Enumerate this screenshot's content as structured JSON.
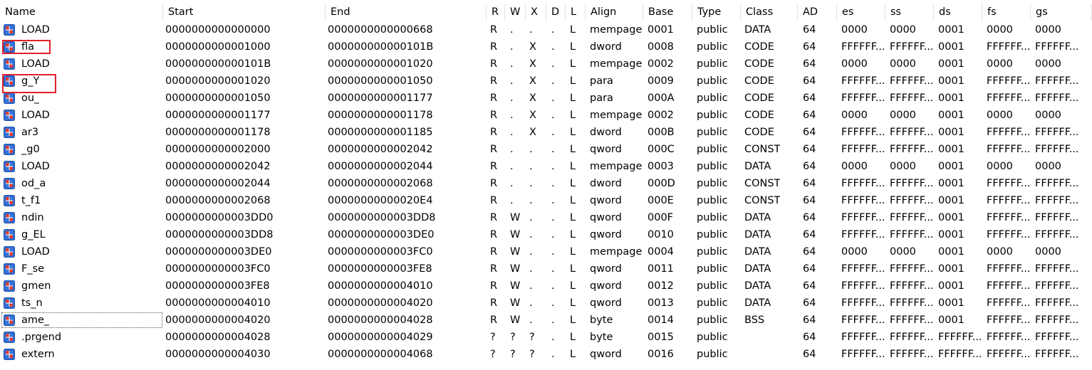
{
  "columns": [
    {
      "key": "name",
      "label": "Name"
    },
    {
      "key": "start",
      "label": "Start"
    },
    {
      "key": "end",
      "label": "End"
    },
    {
      "key": "r",
      "label": "R"
    },
    {
      "key": "w",
      "label": "W"
    },
    {
      "key": "x",
      "label": "X"
    },
    {
      "key": "d",
      "label": "D"
    },
    {
      "key": "l",
      "label": "L"
    },
    {
      "key": "align",
      "label": "Align"
    },
    {
      "key": "base",
      "label": "Base"
    },
    {
      "key": "type",
      "label": "Type"
    },
    {
      "key": "class",
      "label": "Class"
    },
    {
      "key": "ad",
      "label": "AD"
    },
    {
      "key": "es",
      "label": "es"
    },
    {
      "key": "ss",
      "label": "ss"
    },
    {
      "key": "ds",
      "label": "ds"
    },
    {
      "key": "fs",
      "label": "fs"
    },
    {
      "key": "gs",
      "label": "gs"
    }
  ],
  "icon": "segment-icon",
  "highlighted_rows": [
    1,
    3
  ],
  "focused_row": 17,
  "rows": [
    {
      "name": "LOAD",
      "start": "0000000000000000",
      "end": "0000000000000668",
      "r": "R",
      "w": ".",
      "x": ".",
      "d": ".",
      "l": "L",
      "align": "mempage",
      "base": "0001",
      "type": "public",
      "class": "DATA",
      "ad": "64",
      "es": "0000",
      "ss": "0000",
      "ds": "0001",
      "fs": "0000",
      "gs": "0000"
    },
    {
      "name": "fla",
      "start": "0000000000001000",
      "end": "000000000000101B",
      "r": "R",
      "w": ".",
      "x": "X",
      "d": ".",
      "l": "L",
      "align": "dword",
      "base": "0008",
      "type": "public",
      "class": "CODE",
      "ad": "64",
      "es": "FFFFFF...",
      "ss": "FFFFFF...",
      "ds": "0001",
      "fs": "FFFFFF...",
      "gs": "FFFFFF..."
    },
    {
      "name": "LOAD",
      "start": "000000000000101B",
      "end": "0000000000001020",
      "r": "R",
      "w": ".",
      "x": "X",
      "d": ".",
      "l": "L",
      "align": "mempage",
      "base": "0002",
      "type": "public",
      "class": "CODE",
      "ad": "64",
      "es": "0000",
      "ss": "0000",
      "ds": "0001",
      "fs": "0000",
      "gs": "0000"
    },
    {
      "name": "g_Y",
      "start": "0000000000001020",
      "end": "0000000000001050",
      "r": "R",
      "w": ".",
      "x": "X",
      "d": ".",
      "l": "L",
      "align": "para",
      "base": "0009",
      "type": "public",
      "class": "CODE",
      "ad": "64",
      "es": "FFFFFF...",
      "ss": "FFFFFF...",
      "ds": "0001",
      "fs": "FFFFFF...",
      "gs": "FFFFFF..."
    },
    {
      "name": "ou_",
      "start": "0000000000001050",
      "end": "0000000000001177",
      "r": "R",
      "w": ".",
      "x": "X",
      "d": ".",
      "l": "L",
      "align": "para",
      "base": "000A",
      "type": "public",
      "class": "CODE",
      "ad": "64",
      "es": "FFFFFF...",
      "ss": "FFFFFF...",
      "ds": "0001",
      "fs": "FFFFFF...",
      "gs": "FFFFFF..."
    },
    {
      "name": "LOAD",
      "start": "0000000000001177",
      "end": "0000000000001178",
      "r": "R",
      "w": ".",
      "x": "X",
      "d": ".",
      "l": "L",
      "align": "mempage",
      "base": "0002",
      "type": "public",
      "class": "CODE",
      "ad": "64",
      "es": "0000",
      "ss": "0000",
      "ds": "0001",
      "fs": "0000",
      "gs": "0000"
    },
    {
      "name": "ar3",
      "start": "0000000000001178",
      "end": "0000000000001185",
      "r": "R",
      "w": ".",
      "x": "X",
      "d": ".",
      "l": "L",
      "align": "dword",
      "base": "000B",
      "type": "public",
      "class": "CODE",
      "ad": "64",
      "es": "FFFFFF...",
      "ss": "FFFFFF...",
      "ds": "0001",
      "fs": "FFFFFF...",
      "gs": "FFFFFF..."
    },
    {
      "name": "_g0",
      "start": "0000000000002000",
      "end": "0000000000002042",
      "r": "R",
      "w": ".",
      "x": ".",
      "d": ".",
      "l": "L",
      "align": "qword",
      "base": "000C",
      "type": "public",
      "class": "CONST",
      "ad": "64",
      "es": "FFFFFF...",
      "ss": "FFFFFF...",
      "ds": "0001",
      "fs": "FFFFFF...",
      "gs": "FFFFFF..."
    },
    {
      "name": "LOAD",
      "start": "0000000000002042",
      "end": "0000000000002044",
      "r": "R",
      "w": ".",
      "x": ".",
      "d": ".",
      "l": "L",
      "align": "mempage",
      "base": "0003",
      "type": "public",
      "class": "DATA",
      "ad": "64",
      "es": "0000",
      "ss": "0000",
      "ds": "0001",
      "fs": "0000",
      "gs": "0000"
    },
    {
      "name": "od_a",
      "start": "0000000000002044",
      "end": "0000000000002068",
      "r": "R",
      "w": ".",
      "x": ".",
      "d": ".",
      "l": "L",
      "align": "dword",
      "base": "000D",
      "type": "public",
      "class": "CONST",
      "ad": "64",
      "es": "FFFFFF...",
      "ss": "FFFFFF...",
      "ds": "0001",
      "fs": "FFFFFF...",
      "gs": "FFFFFF..."
    },
    {
      "name": "t_f1",
      "start": "0000000000002068",
      "end": "00000000000020E4",
      "r": "R",
      "w": ".",
      "x": ".",
      "d": ".",
      "l": "L",
      "align": "qword",
      "base": "000E",
      "type": "public",
      "class": "CONST",
      "ad": "64",
      "es": "FFFFFF...",
      "ss": "FFFFFF...",
      "ds": "0001",
      "fs": "FFFFFF...",
      "gs": "FFFFFF..."
    },
    {
      "name": "ndin",
      "start": "0000000000003DD0",
      "end": "0000000000003DD8",
      "r": "R",
      "w": "W",
      "x": ".",
      "d": ".",
      "l": "L",
      "align": "qword",
      "base": "000F",
      "type": "public",
      "class": "DATA",
      "ad": "64",
      "es": "FFFFFF...",
      "ss": "FFFFFF...",
      "ds": "0001",
      "fs": "FFFFFF...",
      "gs": "FFFFFF..."
    },
    {
      "name": "g_EL",
      "start": "0000000000003DD8",
      "end": "0000000000003DE0",
      "r": "R",
      "w": "W",
      "x": ".",
      "d": ".",
      "l": "L",
      "align": "qword",
      "base": "0010",
      "type": "public",
      "class": "DATA",
      "ad": "64",
      "es": "FFFFFF...",
      "ss": "FFFFFF...",
      "ds": "0001",
      "fs": "FFFFFF...",
      "gs": "FFFFFF..."
    },
    {
      "name": "LOAD",
      "start": "0000000000003DE0",
      "end": "0000000000003FC0",
      "r": "R",
      "w": "W",
      "x": ".",
      "d": ".",
      "l": "L",
      "align": "mempage",
      "base": "0004",
      "type": "public",
      "class": "DATA",
      "ad": "64",
      "es": "0000",
      "ss": "0000",
      "ds": "0001",
      "fs": "0000",
      "gs": "0000"
    },
    {
      "name": "F_se",
      "start": "0000000000003FC0",
      "end": "0000000000003FE8",
      "r": "R",
      "w": "W",
      "x": ".",
      "d": ".",
      "l": "L",
      "align": "qword",
      "base": "0011",
      "type": "public",
      "class": "DATA",
      "ad": "64",
      "es": "FFFFFF...",
      "ss": "FFFFFF...",
      "ds": "0001",
      "fs": "FFFFFF...",
      "gs": "FFFFFF..."
    },
    {
      "name": "gmen",
      "start": "0000000000003FE8",
      "end": "0000000000004010",
      "r": "R",
      "w": "W",
      "x": ".",
      "d": ".",
      "l": "L",
      "align": "qword",
      "base": "0012",
      "type": "public",
      "class": "DATA",
      "ad": "64",
      "es": "FFFFFF...",
      "ss": "FFFFFF...",
      "ds": "0001",
      "fs": "FFFFFF...",
      "gs": "FFFFFF..."
    },
    {
      "name": "ts_n",
      "start": "0000000000004010",
      "end": "0000000000004020",
      "r": "R",
      "w": "W",
      "x": ".",
      "d": ".",
      "l": "L",
      "align": "qword",
      "base": "0013",
      "type": "public",
      "class": "DATA",
      "ad": "64",
      "es": "FFFFFF...",
      "ss": "FFFFFF...",
      "ds": "0001",
      "fs": "FFFFFF...",
      "gs": "FFFFFF..."
    },
    {
      "name": "ame_",
      "start": "0000000000004020",
      "end": "0000000000004028",
      "r": "R",
      "w": "W",
      "x": ".",
      "d": ".",
      "l": "L",
      "align": "byte",
      "base": "0014",
      "type": "public",
      "class": "BSS",
      "ad": "64",
      "es": "FFFFFF...",
      "ss": "FFFFFF...",
      "ds": "0001",
      "fs": "FFFFFF...",
      "gs": "FFFFFF..."
    },
    {
      "name": ".prgend",
      "start": "0000000000004028",
      "end": "0000000000004029",
      "r": "?",
      "w": "?",
      "x": "?",
      "d": ".",
      "l": "L",
      "align": "byte",
      "base": "0015",
      "type": "public",
      "class": "",
      "ad": "64",
      "es": "FFFFFF...",
      "ss": "FFFFFF...",
      "ds": "FFFFFF...",
      "fs": "FFFFFF...",
      "gs": "FFFFFF..."
    },
    {
      "name": "extern",
      "start": "0000000000004030",
      "end": "0000000000004068",
      "r": "?",
      "w": "?",
      "x": "?",
      "d": ".",
      "l": "L",
      "align": "qword",
      "base": "0016",
      "type": "public",
      "class": "",
      "ad": "64",
      "es": "FFFFFF...",
      "ss": "FFFFFF...",
      "ds": "FFFFFF...",
      "fs": "FFFFFF...",
      "gs": "FFFFFF..."
    }
  ]
}
